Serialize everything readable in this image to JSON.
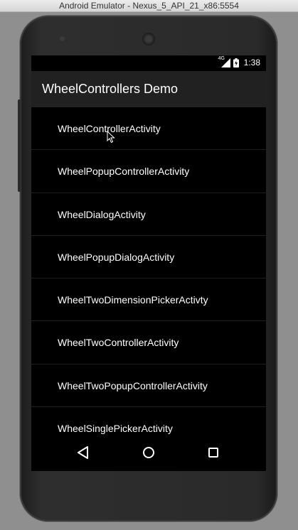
{
  "window": {
    "title": "Android Emulator - Nexus_5_API_21_x86:5554"
  },
  "status_bar": {
    "network": "4G",
    "time": "1:38"
  },
  "action_bar": {
    "title": "WheelControllers Demo"
  },
  "activities": [
    {
      "label": "WheelControllerActivity"
    },
    {
      "label": "WheelPopupControllerActivity"
    },
    {
      "label": "WheelDialogActivity"
    },
    {
      "label": "WheelPopupDialogActivity"
    },
    {
      "label": "WheelTwoDimensionPickerActivty"
    },
    {
      "label": "WheelTwoControllerActivity"
    },
    {
      "label": "WheelTwoPopupControllerActivity"
    },
    {
      "label": "WheelSinglePickerActivity"
    }
  ],
  "nav_bar": {
    "icons": [
      "back-icon",
      "home-icon",
      "recents-icon"
    ]
  },
  "colors": {
    "action_bar": "#212121",
    "screen_bg": "#000000",
    "text": "#ffffff"
  }
}
